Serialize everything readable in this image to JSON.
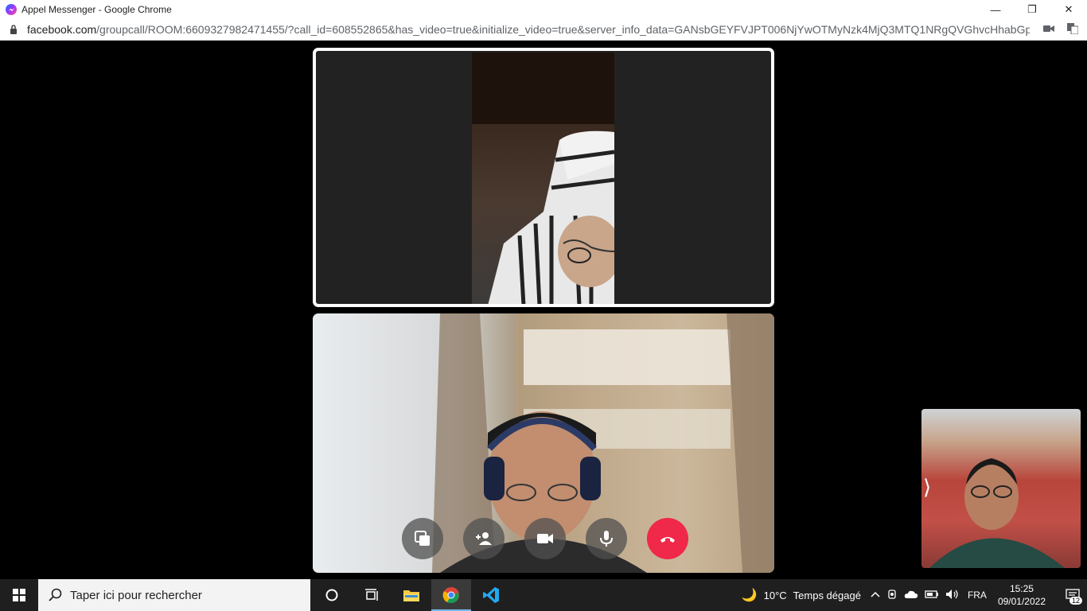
{
  "window": {
    "title": "Appel Messenger - Google Chrome",
    "controls": {
      "minimize": "—",
      "restore": "❐",
      "close": "✕"
    }
  },
  "address_bar": {
    "host": "facebook.com",
    "path": "/groupcall/ROOM:6609327982471455/?call_id=608552865&has_video=true&initialize_video=true&server_info_data=GANsbGEYFVJPT006NjYwOTMyNzk4MjQ3MTQ1NRgQVGhvcHhabGp6..."
  },
  "call": {
    "participants": [
      "remote-participant-1",
      "remote-participant-2",
      "self-view"
    ],
    "controls": [
      "switch-view",
      "add-person",
      "toggle-camera",
      "toggle-mic",
      "end-call"
    ],
    "end_call_color": "#f02849"
  },
  "taskbar": {
    "search_placeholder": "Taper ici pour rechercher",
    "weather_temp": "10°C",
    "weather_text": "Temps dégagé",
    "language": "FRA",
    "time": "15:25",
    "date": "09/01/2022",
    "notification_count": "12"
  }
}
